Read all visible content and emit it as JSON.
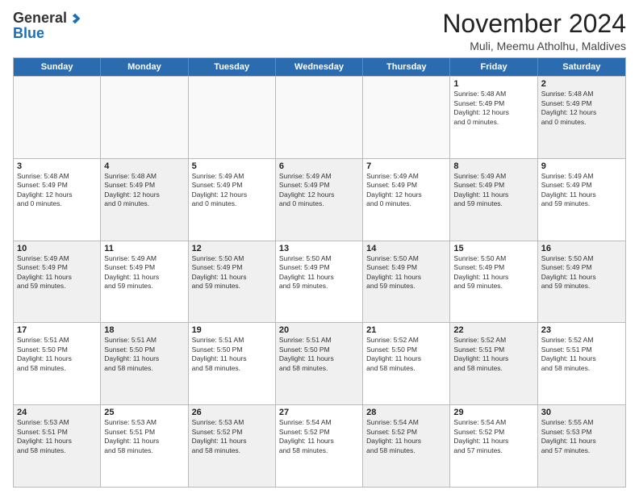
{
  "logo": {
    "general": "General",
    "blue": "Blue"
  },
  "header": {
    "month": "November 2024",
    "location": "Muli, Meemu Atholhu, Maldives"
  },
  "days": [
    "Sunday",
    "Monday",
    "Tuesday",
    "Wednesday",
    "Thursday",
    "Friday",
    "Saturday"
  ],
  "weeks": [
    [
      {
        "day": "",
        "empty": true
      },
      {
        "day": "",
        "empty": true
      },
      {
        "day": "",
        "empty": true
      },
      {
        "day": "",
        "empty": true
      },
      {
        "day": "",
        "empty": true
      },
      {
        "day": "1",
        "lines": [
          "Sunrise: 5:48 AM",
          "Sunset: 5:49 PM",
          "Daylight: 12 hours",
          "and 0 minutes."
        ]
      },
      {
        "day": "2",
        "lines": [
          "Sunrise: 5:48 AM",
          "Sunset: 5:49 PM",
          "Daylight: 12 hours",
          "and 0 minutes."
        ],
        "shaded": true
      }
    ],
    [
      {
        "day": "3",
        "lines": [
          "Sunrise: 5:48 AM",
          "Sunset: 5:49 PM",
          "Daylight: 12 hours",
          "and 0 minutes."
        ]
      },
      {
        "day": "4",
        "lines": [
          "Sunrise: 5:48 AM",
          "Sunset: 5:49 PM",
          "Daylight: 12 hours",
          "and 0 minutes."
        ],
        "shaded": true
      },
      {
        "day": "5",
        "lines": [
          "Sunrise: 5:49 AM",
          "Sunset: 5:49 PM",
          "Daylight: 12 hours",
          "and 0 minutes."
        ]
      },
      {
        "day": "6",
        "lines": [
          "Sunrise: 5:49 AM",
          "Sunset: 5:49 PM",
          "Daylight: 12 hours",
          "and 0 minutes."
        ],
        "shaded": true
      },
      {
        "day": "7",
        "lines": [
          "Sunrise: 5:49 AM",
          "Sunset: 5:49 PM",
          "Daylight: 12 hours",
          "and 0 minutes."
        ]
      },
      {
        "day": "8",
        "lines": [
          "Sunrise: 5:49 AM",
          "Sunset: 5:49 PM",
          "Daylight: 11 hours",
          "and 59 minutes."
        ],
        "shaded": true
      },
      {
        "day": "9",
        "lines": [
          "Sunrise: 5:49 AM",
          "Sunset: 5:49 PM",
          "Daylight: 11 hours",
          "and 59 minutes."
        ]
      }
    ],
    [
      {
        "day": "10",
        "lines": [
          "Sunrise: 5:49 AM",
          "Sunset: 5:49 PM",
          "Daylight: 11 hours",
          "and 59 minutes."
        ],
        "shaded": true
      },
      {
        "day": "11",
        "lines": [
          "Sunrise: 5:49 AM",
          "Sunset: 5:49 PM",
          "Daylight: 11 hours",
          "and 59 minutes."
        ]
      },
      {
        "day": "12",
        "lines": [
          "Sunrise: 5:50 AM",
          "Sunset: 5:49 PM",
          "Daylight: 11 hours",
          "and 59 minutes."
        ],
        "shaded": true
      },
      {
        "day": "13",
        "lines": [
          "Sunrise: 5:50 AM",
          "Sunset: 5:49 PM",
          "Daylight: 11 hours",
          "and 59 minutes."
        ]
      },
      {
        "day": "14",
        "lines": [
          "Sunrise: 5:50 AM",
          "Sunset: 5:49 PM",
          "Daylight: 11 hours",
          "and 59 minutes."
        ],
        "shaded": true
      },
      {
        "day": "15",
        "lines": [
          "Sunrise: 5:50 AM",
          "Sunset: 5:49 PM",
          "Daylight: 11 hours",
          "and 59 minutes."
        ]
      },
      {
        "day": "16",
        "lines": [
          "Sunrise: 5:50 AM",
          "Sunset: 5:49 PM",
          "Daylight: 11 hours",
          "and 59 minutes."
        ],
        "shaded": true
      }
    ],
    [
      {
        "day": "17",
        "lines": [
          "Sunrise: 5:51 AM",
          "Sunset: 5:50 PM",
          "Daylight: 11 hours",
          "and 58 minutes."
        ]
      },
      {
        "day": "18",
        "lines": [
          "Sunrise: 5:51 AM",
          "Sunset: 5:50 PM",
          "Daylight: 11 hours",
          "and 58 minutes."
        ],
        "shaded": true
      },
      {
        "day": "19",
        "lines": [
          "Sunrise: 5:51 AM",
          "Sunset: 5:50 PM",
          "Daylight: 11 hours",
          "and 58 minutes."
        ]
      },
      {
        "day": "20",
        "lines": [
          "Sunrise: 5:51 AM",
          "Sunset: 5:50 PM",
          "Daylight: 11 hours",
          "and 58 minutes."
        ],
        "shaded": true
      },
      {
        "day": "21",
        "lines": [
          "Sunrise: 5:52 AM",
          "Sunset: 5:50 PM",
          "Daylight: 11 hours",
          "and 58 minutes."
        ]
      },
      {
        "day": "22",
        "lines": [
          "Sunrise: 5:52 AM",
          "Sunset: 5:51 PM",
          "Daylight: 11 hours",
          "and 58 minutes."
        ],
        "shaded": true
      },
      {
        "day": "23",
        "lines": [
          "Sunrise: 5:52 AM",
          "Sunset: 5:51 PM",
          "Daylight: 11 hours",
          "and 58 minutes."
        ]
      }
    ],
    [
      {
        "day": "24",
        "lines": [
          "Sunrise: 5:53 AM",
          "Sunset: 5:51 PM",
          "Daylight: 11 hours",
          "and 58 minutes."
        ],
        "shaded": true
      },
      {
        "day": "25",
        "lines": [
          "Sunrise: 5:53 AM",
          "Sunset: 5:51 PM",
          "Daylight: 11 hours",
          "and 58 minutes."
        ]
      },
      {
        "day": "26",
        "lines": [
          "Sunrise: 5:53 AM",
          "Sunset: 5:52 PM",
          "Daylight: 11 hours",
          "and 58 minutes."
        ],
        "shaded": true
      },
      {
        "day": "27",
        "lines": [
          "Sunrise: 5:54 AM",
          "Sunset: 5:52 PM",
          "Daylight: 11 hours",
          "and 58 minutes."
        ]
      },
      {
        "day": "28",
        "lines": [
          "Sunrise: 5:54 AM",
          "Sunset: 5:52 PM",
          "Daylight: 11 hours",
          "and 58 minutes."
        ],
        "shaded": true
      },
      {
        "day": "29",
        "lines": [
          "Sunrise: 5:54 AM",
          "Sunset: 5:52 PM",
          "Daylight: 11 hours",
          "and 57 minutes."
        ]
      },
      {
        "day": "30",
        "lines": [
          "Sunrise: 5:55 AM",
          "Sunset: 5:53 PM",
          "Daylight: 11 hours",
          "and 57 minutes."
        ],
        "shaded": true
      }
    ]
  ]
}
